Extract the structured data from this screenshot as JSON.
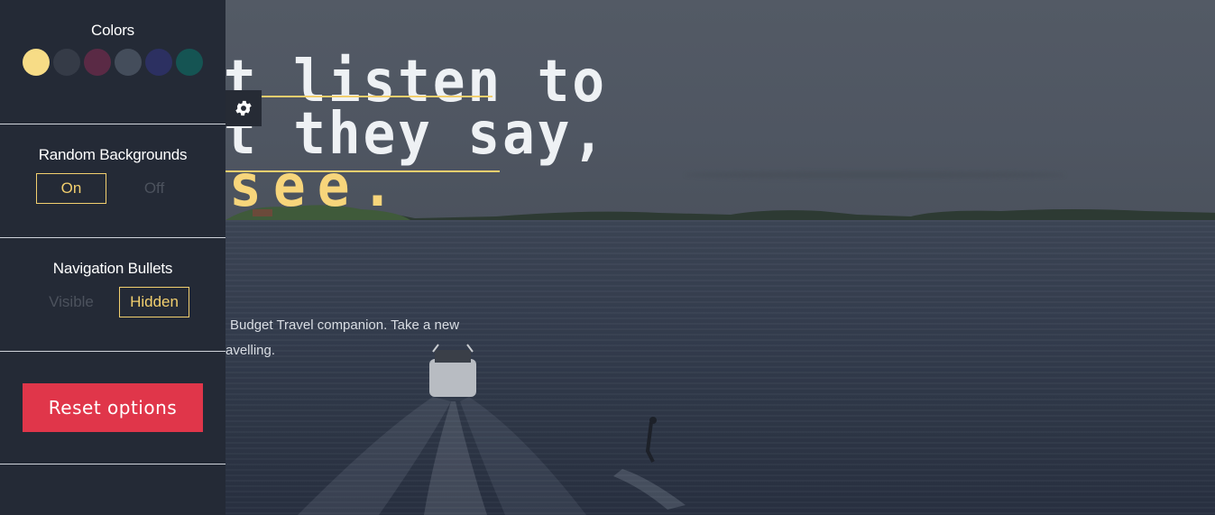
{
  "hero": {
    "headline_line1": "t listen to",
    "headline_line2": "t they say,",
    "headline_line3": "see.",
    "subtext_line1": "Budget Travel companion. Take a new",
    "subtext_line2": "avelling."
  },
  "panel": {
    "colors": {
      "title": "Colors",
      "swatches": [
        "#f7dc86",
        "#353b47",
        "#5a2a45",
        "#444d5b",
        "#2c3061",
        "#155453"
      ]
    },
    "random_backgrounds": {
      "title": "Random Backgrounds",
      "on_label": "On",
      "off_label": "Off",
      "selected": "On"
    },
    "navigation_bullets": {
      "title": "Navigation Bullets",
      "visible_label": "Visible",
      "hidden_label": "Hidden",
      "selected": "Hidden"
    },
    "reset_label": "Reset options"
  },
  "accent_color": "#f2cf6e",
  "icons": {
    "settings": "gear-icon"
  }
}
